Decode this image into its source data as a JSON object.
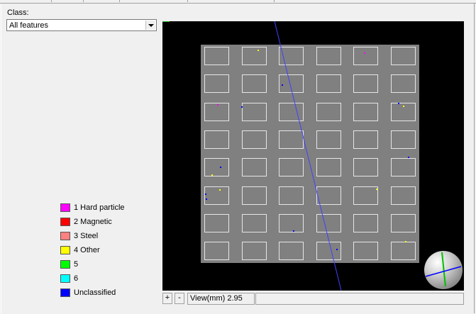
{
  "class_filter": {
    "label": "Class:",
    "selected": "All features"
  },
  "legend": [
    {
      "label": "1 Hard particle",
      "color": "#ff00ff"
    },
    {
      "label": "2 Magnetic",
      "color": "#ff0000"
    },
    {
      "label": "3 Steel",
      "color": "#ff8080"
    },
    {
      "label": "4 Other",
      "color": "#ffff00"
    },
    {
      "label": "5",
      "color": "#00ff00"
    },
    {
      "label": "6",
      "color": "#00ffff"
    },
    {
      "label": "Unclassified",
      "color": "#0000ff"
    }
  ],
  "view": {
    "zoom_in_label": "+",
    "zoom_out_label": "-",
    "view_text": "View(mm) 2.95",
    "status_text": ""
  },
  "scene": {
    "grid_rows": 8,
    "grid_cols": 6,
    "plate_color": "#808080",
    "cell_border_color": "#e6e6e6",
    "scan_line_color": "#4040ff"
  }
}
